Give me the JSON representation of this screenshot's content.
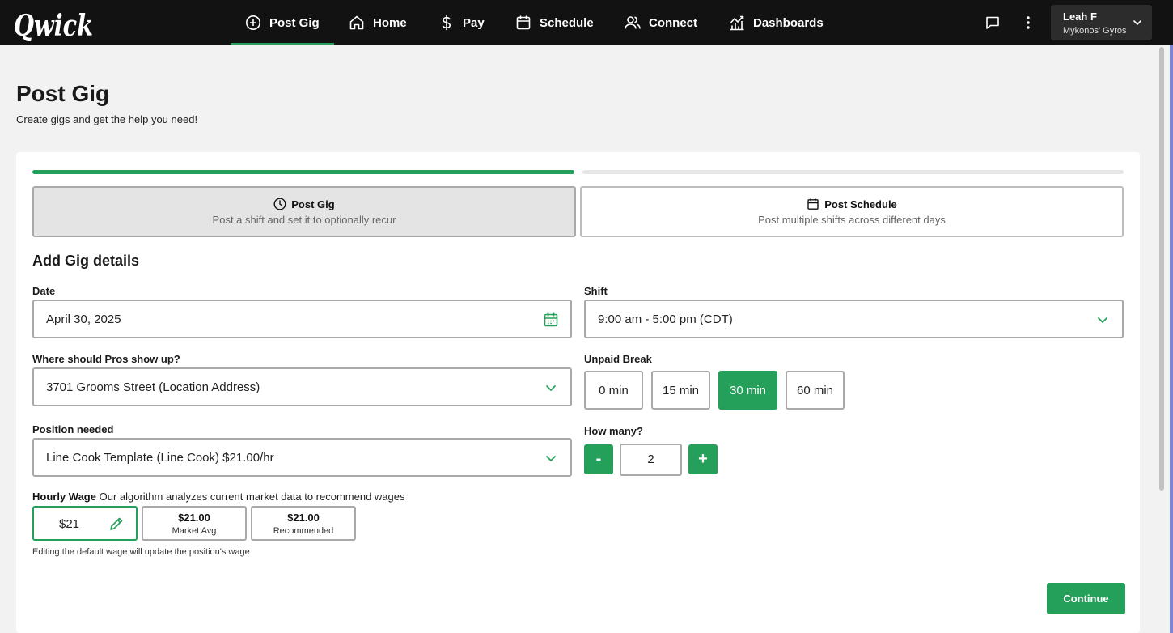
{
  "app": {
    "logo_text": "Qwick"
  },
  "nav": {
    "items": [
      {
        "label": "Post Gig",
        "icon": "plus-circle-icon",
        "active": true
      },
      {
        "label": "Home",
        "icon": "home-icon"
      },
      {
        "label": "Pay",
        "icon": "dollar-icon"
      },
      {
        "label": "Schedule",
        "icon": "calendar-icon"
      },
      {
        "label": "Connect",
        "icon": "users-icon"
      },
      {
        "label": "Dashboards",
        "icon": "chart-icon"
      }
    ],
    "messages_icon": "chat-icon",
    "more_icon": "kebab-menu-icon",
    "user": {
      "name": "Leah F",
      "business": "Mykonos' Gyros"
    }
  },
  "page": {
    "title": "Post Gig",
    "subtitle": "Create gigs and get the help you need!"
  },
  "wizard": {
    "progress_fraction": 0.5,
    "modes": [
      {
        "title": "Post Gig",
        "description": "Post a shift and set it to optionally recur",
        "icon": "clock-icon",
        "active": true
      },
      {
        "title": "Post Schedule",
        "description": "Post multiple shifts across different days",
        "icon": "calendar-icon",
        "active": false
      }
    ]
  },
  "form": {
    "section_title": "Add Gig details",
    "date": {
      "label": "Date",
      "value": "April 30, 2025"
    },
    "shift": {
      "label": "Shift",
      "value": "9:00 am - 5:00 pm (CDT)"
    },
    "location": {
      "label": "Where should Pros show up?",
      "value": "3701 Grooms Street (Location Address)"
    },
    "unpaid_break": {
      "label": "Unpaid Break",
      "options": [
        "0 min",
        "15 min",
        "30 min",
        "60 min"
      ],
      "selected": "30 min"
    },
    "position": {
      "label": "Position needed",
      "value": "Line Cook Template (Line Cook) $21.00/hr"
    },
    "how_many": {
      "label": "How many?",
      "value": "2",
      "minus": "-",
      "plus": "+"
    },
    "hourly_wage": {
      "label": "Hourly Wage",
      "description": "Our algorithm analyzes current market data to recommend wages",
      "value": "$21",
      "market_avg": {
        "amount": "$21.00",
        "label": "Market Avg"
      },
      "recommended": {
        "amount": "$21.00",
        "label": "Recommended"
      },
      "note": "Editing the default wage will update the position's wage"
    },
    "continue_label": "Continue"
  },
  "colors": {
    "accent": "#25a05a",
    "topbar": "#121212"
  }
}
